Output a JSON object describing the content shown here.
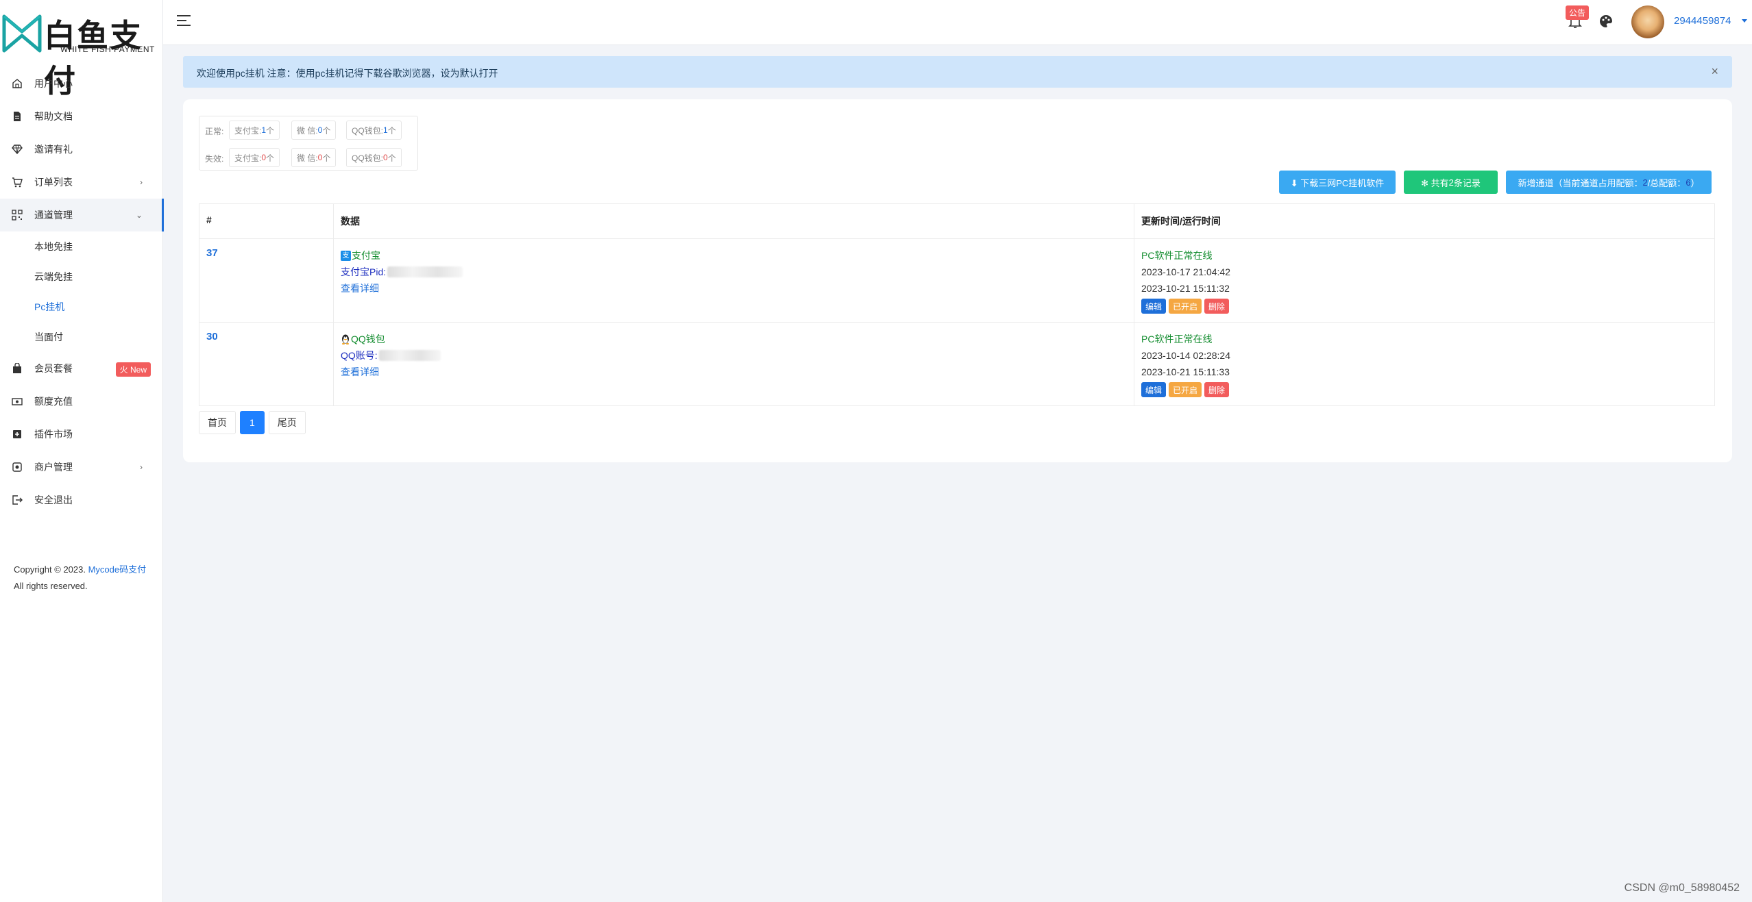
{
  "brand": {
    "name": "白鱼支付",
    "subtitle": "WHITE FISH PAYMENT"
  },
  "sidebar": {
    "items": [
      {
        "label": "用户中心",
        "icon": "home-icon"
      },
      {
        "label": "帮助文档",
        "icon": "document-icon"
      },
      {
        "label": "邀请有礼",
        "icon": "diamond-icon"
      },
      {
        "label": "订单列表",
        "icon": "cart-icon",
        "arrow": "›"
      },
      {
        "label": "通道管理",
        "icon": "qrcode-icon",
        "arrow": "⌄"
      },
      {
        "label": "会员套餐",
        "icon": "bag-icon",
        "badge": "火 New"
      },
      {
        "label": "额度充值",
        "icon": "money-icon"
      },
      {
        "label": "插件市场",
        "icon": "plugin-icon"
      },
      {
        "label": "商户管理",
        "icon": "merchant-icon",
        "arrow": "›"
      },
      {
        "label": "安全退出",
        "icon": "logout-icon"
      }
    ],
    "subitems": [
      "本地免挂",
      "云端免挂",
      "Pc挂机",
      "当面付"
    ],
    "copyright": {
      "prefix": "Copyright © 2023. ",
      "link": "Mycode码支付",
      "suffix": " All rights reserved."
    }
  },
  "header": {
    "notice_badge": "公告",
    "username": "2944459874"
  },
  "alert": {
    "text": "欢迎使用pc挂机 注意：使用pc挂机记得下载谷歌浏览器，设为默认打开",
    "close": "×"
  },
  "stats": {
    "normal_label": "正常:",
    "invalid_label": "失效:",
    "normal": [
      {
        "name": "支付宝:",
        "count": "1",
        "unit": "个"
      },
      {
        "name": "微 信:",
        "count": "0",
        "unit": "个"
      },
      {
        "name": "QQ钱包:",
        "count": "1",
        "unit": "个"
      }
    ],
    "invalid": [
      {
        "name": "支付宝:",
        "count": "0",
        "unit": "个"
      },
      {
        "name": "微 信:",
        "count": "0",
        "unit": "个"
      },
      {
        "name": "QQ钱包:",
        "count": "0",
        "unit": "个"
      }
    ]
  },
  "actions": {
    "download": "⬇ 下载三网PC挂机软件",
    "count_prefix": "✻ 共有 ",
    "count_value": "2",
    "count_suffix": " 条记录",
    "new_prefix": "新增通道（当前通道占用配额：",
    "new_used": "2",
    "new_mid": "/总配额：",
    "new_total": "6",
    "new_suffix": "）"
  },
  "table": {
    "headers": [
      "#",
      "数据",
      "更新时间/运行时间"
    ],
    "rows": [
      {
        "id": "37",
        "type": "支付宝",
        "type_icon": "alipay-icon",
        "account_label": "支付宝Pid:",
        "detail": "查看详细",
        "status": "PC软件正常在线",
        "updated": "2023-10-17 21:04:42",
        "running": "2023-10-21 15:11:32",
        "ops": [
          "编辑",
          "已开启",
          "删除"
        ]
      },
      {
        "id": "30",
        "type": "QQ钱包",
        "type_icon": "qq-penguin-icon",
        "account_label": "QQ账号:",
        "detail": "查看详细",
        "status": "PC软件正常在线",
        "updated": "2023-10-14 02:28:24",
        "running": "2023-10-21 15:11:33",
        "ops": [
          "编辑",
          "已开启",
          "删除"
        ]
      }
    ]
  },
  "pager": {
    "first": "首页",
    "current": "1",
    "last": "尾页"
  },
  "watermark": "CSDN @m0_58980452",
  "colors": {
    "primary": "#1e6fd9",
    "success": "#1fc67a",
    "info": "#3aa9f2",
    "warning": "#f5a742",
    "danger": "#f25c5c"
  }
}
